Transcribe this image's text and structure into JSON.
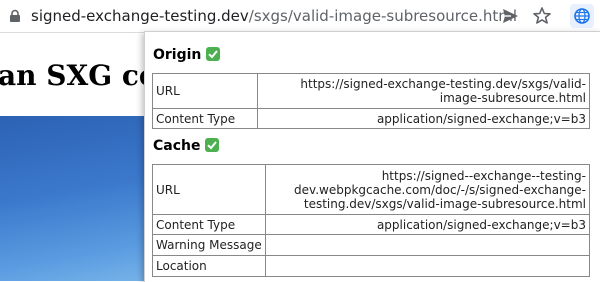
{
  "browser": {
    "url_host": "signed-exchange-testing.dev",
    "url_path": "/sxgs/valid-image-subresource.html"
  },
  "page": {
    "heading": "an SXG co"
  },
  "popup": {
    "origin": {
      "title": "Origin",
      "rows": [
        {
          "key": "URL",
          "value": "https://signed-exchange-testing.dev/sxgs/valid-image-subresource.html"
        },
        {
          "key": "Content Type",
          "value": "application/signed-exchange;v=b3"
        }
      ]
    },
    "cache": {
      "title": "Cache",
      "rows": [
        {
          "key": "URL",
          "value": "https://signed--exchange--testing-dev.webpkgcache.com/doc/-/s/signed-exchange-testing.dev/sxgs/valid-image-subresource.html"
        },
        {
          "key": "Content Type",
          "value": "application/signed-exchange;v=b3"
        },
        {
          "key": "Warning Message",
          "value": ""
        },
        {
          "key": "Location",
          "value": ""
        }
      ]
    }
  },
  "icons": {
    "lock": "lock-icon",
    "send": "send-icon",
    "bookmark": "star-icon",
    "extension": "globe-icon",
    "status": "checkmark-icon"
  },
  "colors": {
    "check_green": "#4caf50",
    "ext_active_bg": "#e8f0fe",
    "ext_icon": "#1a73e8"
  }
}
